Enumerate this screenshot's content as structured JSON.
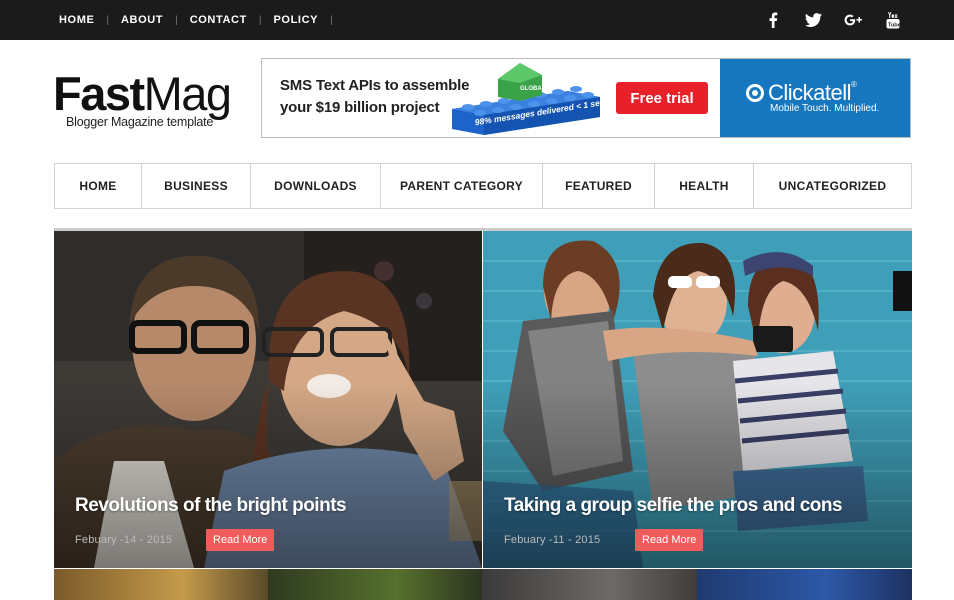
{
  "topnav": {
    "items": [
      "HOME",
      "ABOUT",
      "CONTACT",
      "POLICY"
    ],
    "separator": "|"
  },
  "social": {
    "icons": [
      "facebook-icon",
      "twitter-icon",
      "google-plus-icon",
      "youtube-icon"
    ]
  },
  "logo": {
    "name_bold": "Fast",
    "name_light": "Mag",
    "tagline": "Blogger Magazine template"
  },
  "ad": {
    "line1": "SMS Text APIs to assemble",
    "line2": "your $19 billion project",
    "bricks_label": "GLOBAL",
    "bricks_text": "98% messages delivered < 1 sec.",
    "button": "Free trial",
    "brand": "Clickatell",
    "brand_mark": "®",
    "brand_tagline": "Mobile Touch. Multiplied.",
    "brand_color": "#1677bf",
    "button_color": "#e8202a"
  },
  "mainnav": {
    "items": [
      "HOME",
      "BUSINESS",
      "DOWNLOADS",
      "PARENT CATEGORY",
      "FEATURED",
      "HEALTH",
      "UNCATEGORIZED"
    ]
  },
  "featured": {
    "posts": [
      {
        "title": "Revolutions of the bright points",
        "date": "Febuary -14 - 2015",
        "button": "Read More"
      },
      {
        "title": "Taking a group selfie the pros and cons",
        "date": "Febuary -11 - 2015",
        "button": "Read More"
      }
    ],
    "accent": "#f05c5c"
  }
}
